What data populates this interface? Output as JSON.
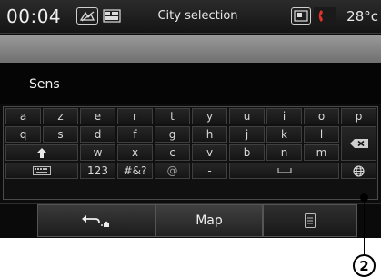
{
  "status": {
    "time": "00:04",
    "title": "City selection",
    "temperature": "28°c"
  },
  "input": {
    "value": "Sens"
  },
  "keyboard": {
    "row1": [
      "a",
      "z",
      "e",
      "r",
      "t",
      "y",
      "u",
      "i",
      "o",
      "p"
    ],
    "row2": [
      "q",
      "s",
      "d",
      "f",
      "g",
      "h",
      "j",
      "k",
      "l"
    ],
    "row3": [
      "w",
      "x",
      "c",
      "v",
      "b",
      "n",
      "m"
    ],
    "row4": [
      "123",
      "#&?",
      "@",
      "-"
    ]
  },
  "bottom": {
    "map_label": "Map"
  },
  "callout": {
    "label": "2"
  },
  "icons": {
    "status": [
      "navigation-icon",
      "media-source-icon",
      "phone-book-icon",
      "phone-call-icon"
    ],
    "keys": [
      "shift-icon",
      "keyboard-layout-icon",
      "space-icon",
      "backspace-icon",
      "globe-icon"
    ],
    "bottom": [
      "back-home-icon",
      "list-icon"
    ]
  },
  "colors": {
    "screen_bg": "#0c0c0c",
    "gray_band": "#8a8a8a",
    "phone_accent": "#e0322a"
  }
}
